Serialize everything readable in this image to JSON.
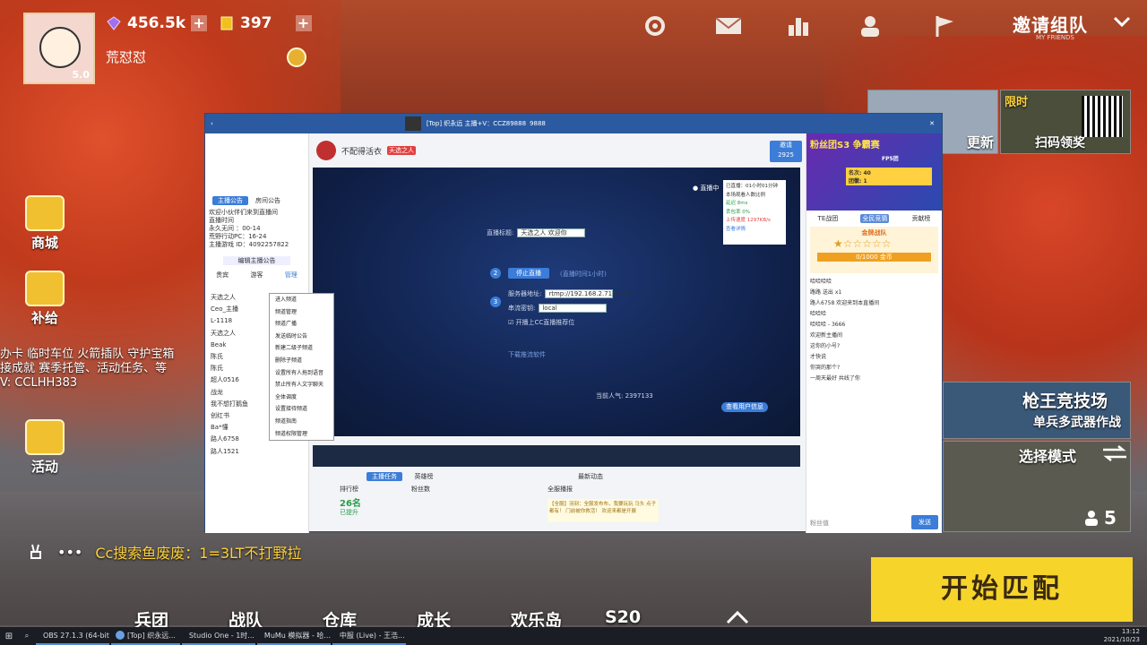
{
  "hud": {
    "player_name": "荒怼怼",
    "level": "5.0",
    "diamonds": "456.5k",
    "gold": "397",
    "invite_label": "邀请组队",
    "invite_sub": "MY FRIENDS"
  },
  "side_menu": [
    {
      "label": "商城",
      "icon": "shop-icon"
    },
    {
      "label": "补给",
      "icon": "supply-icon"
    },
    {
      "label": "活动",
      "icon": "gift-icon"
    }
  ],
  "chat_overlay": {
    "line1": "办卡 临时车位 火箭插队 守护宝箱",
    "line2": "接成就 赛季托管、活动任务、等",
    "line3": "V: CCLHH383"
  },
  "bottom_chat": {
    "dots": "•••",
    "message": "Cc搜索鱼废废：1=3LT不打野拉"
  },
  "right_cards": {
    "car_update": "更新",
    "limited": "限时",
    "scan_reward": "扫码领奖",
    "gun_arena": "枪王竞技场",
    "gun_arena_sub": "单兵多武器作战",
    "select_mode": "选择模式",
    "players_count": "5",
    "start_match": "开始匹配"
  },
  "bottom_nav": [
    "兵团",
    "战队",
    "仓库",
    "成长",
    "欢乐岛",
    "S20"
  ],
  "cc_window": {
    "title": "[Top] 织永远 主播+V：CCZ89888",
    "room_id": "9888",
    "anchor_name": "不配得活衣",
    "badge": "天选之人",
    "left_tabs": [
      "主播公告",
      "房间公告"
    ],
    "announcement": [
      "欢迎小伙伴们来到直播间",
      "直播时间",
      "永久无间 ：00-14",
      "荒野行动PC：16-24",
      "主播游戏 ID：4092257822"
    ],
    "edit_announce": "编辑主播公告",
    "user_tabs": [
      "贵宾",
      "游客",
      "管理"
    ],
    "users": [
      "天选之人",
      "Ceo_主播",
      "L-1118",
      "天选之人",
      "Beak",
      "陈氏",
      "陈氏",
      "超人0516",
      "战龙",
      "我不想打鹅鱼",
      "创红书",
      "Ba*懂",
      "路人6758",
      "路人1521"
    ],
    "ctx_menu": [
      "进入频道",
      "频道管理",
      "频道广播",
      "发送临时公告",
      "新建二级子频道",
      "删除子频道",
      "设置所有人拖到语音",
      "禁止所有人文字聊天",
      "全体调度",
      "设置接待频道",
      "频道指南",
      "频道权限管理"
    ],
    "live_badge": "直播中",
    "stream_title_label": "直播标题:",
    "stream_title_value": "天选之人 欢迎你",
    "step2_button": "停止直播",
    "step2_link": "(直播时间1小时)",
    "rtmp_label": "服务器地址:",
    "rtmp_value": "rtmp://192.168.2.71:1935",
    "key_label": "串流密钥:",
    "key_value": "local",
    "checkbox": "开播上CC直播推荐位",
    "bottom_link": "下载推流软件",
    "popularity": "当前人气: 2397133",
    "share_button": "查看用户信息",
    "stats_lines": [
      "已直播：01小时01分钟",
      "本场观看人数比例",
      "延迟 8ms",
      "丢包率 0%",
      "上传速度 1297KB/s",
      "查看详情"
    ],
    "watch_btn": "邀请",
    "watch_count": "2925",
    "tabs_bottom": [
      "主播任务",
      "英雄榜"
    ],
    "rank_label": "排行榜",
    "score": "26名",
    "score_sub": "已提升",
    "fans_label": "粉丝数",
    "broadcast_title": "最新动态",
    "broadcast_tag": "全服播报",
    "broadcast_text": "【全服】羽刻：全服发布布，我要玩玩 马头 点子都有！ 门前被你救活！ 欢迎来都是开展"
  },
  "cc_right": {
    "banner_title": "粉丝团S3 争霸赛",
    "banner_sub": "FP5团",
    "rank_text": "名次: 40",
    "team_text": "团徽: 1",
    "tabs": [
      "TE战团",
      "全民竞猜",
      "贡献榜"
    ],
    "contest": "金牌战队",
    "stars_progress": "0/1000 金币",
    "chat": [
      "哈哈哈哈",
      "路路 送出 x1",
      "路人6758 欢迎来到本直播间",
      "哈哈哈",
      "哈哈哈 - 3666",
      "欢迎新主播间",
      "这你的小号?",
      "才快说",
      "你哭的那个?",
      "一周天最好 共线了你"
    ],
    "send_btn": "发送",
    "chat_placeholder": "粉丝值"
  },
  "taskbar": {
    "apps": [
      "OBS 27.1.3 (64-bit...)",
      "[Top] 织永远...",
      "Studio One - 1时...",
      "MuMu 模拟器 - 哈...",
      "中服 (Live) - 王浩..."
    ],
    "time": "13:12",
    "date": "2021/10/23"
  }
}
